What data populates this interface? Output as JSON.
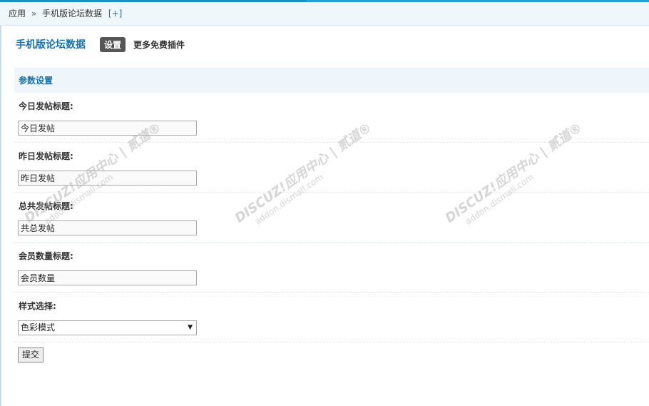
{
  "breadcrumb": {
    "root": "应用",
    "separator": "»",
    "current": "手机版论坛数据",
    "add": "[+]"
  },
  "header": {
    "title": "手机版论坛数据",
    "tab_settings": "设置",
    "tab_more": "更多免费插件"
  },
  "section": {
    "title": "参数设置"
  },
  "fields": [
    {
      "label": "今日发帖标题:",
      "value": "今日发帖"
    },
    {
      "label": "昨日发帖标题:",
      "value": "昨日发帖"
    },
    {
      "label": "总共发帖标题:",
      "value": "共总发帖"
    },
    {
      "label": "会员数量标题:",
      "value": "会员数量"
    }
  ],
  "style_field": {
    "label": "样式选择:",
    "selected": "色彩模式"
  },
  "submit_label": "提交",
  "watermark": {
    "line1": "DISCUZ!应用中心 | 贰道®",
    "line2": "addon.dismall.com"
  },
  "colors": {
    "accent": "#1a73a8",
    "topbar": "#1e8fc6",
    "section_bg": "#eef6fb",
    "tab_active_bg": "#555555"
  }
}
